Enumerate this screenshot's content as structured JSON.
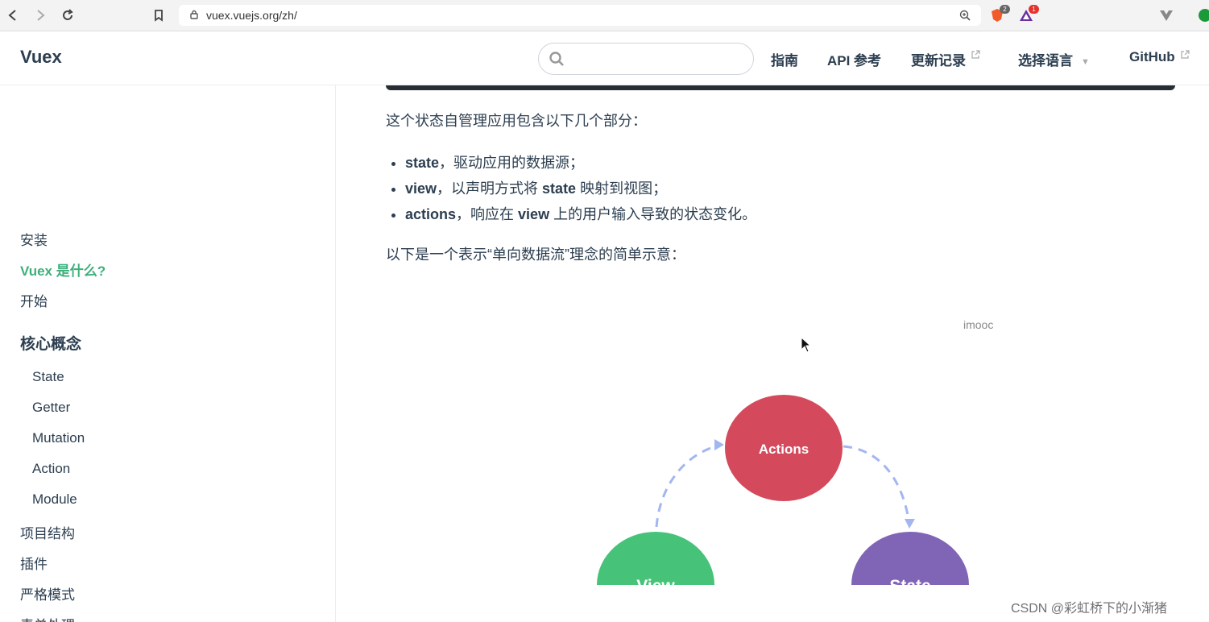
{
  "browser": {
    "url": "vuex.vuejs.org/zh/",
    "back_icon": "back-arrow-icon",
    "forward_icon": "forward-arrow-icon",
    "reload_icon": "reload-icon",
    "bookmark_icon": "bookmark-icon",
    "lock_icon": "lock-icon",
    "zoom_icon": "zoom-icon",
    "extensions": [
      {
        "name": "brave-shields-icon",
        "badge": "2"
      },
      {
        "name": "brave-rewards-icon",
        "badge": "1"
      }
    ]
  },
  "header": {
    "brand": "Vuex",
    "search_placeholder": "",
    "nav": [
      {
        "label": "指南"
      },
      {
        "label": "API 参考"
      },
      {
        "label": "更新记录",
        "external": true
      },
      {
        "label": "选择语言",
        "dropdown": true
      },
      {
        "label": "GitHub",
        "external": true
      }
    ]
  },
  "sidebar": {
    "items": [
      {
        "label": "安装"
      },
      {
        "label": "Vuex 是什么?",
        "active": true
      },
      {
        "label": "开始"
      }
    ],
    "heading": "核心概念",
    "sub_items": [
      "State",
      "Getter",
      "Mutation",
      "Action",
      "Module"
    ],
    "more_items": [
      "项目结构",
      "插件",
      "严格模式",
      "表单处理"
    ]
  },
  "content": {
    "intro": "这个状态自管理应用包含以下几个部分：",
    "list": [
      {
        "term": "state",
        "rest": "，驱动应用的数据源；"
      },
      {
        "term": "view",
        "rest_a": "，以声明方式将 ",
        "term2": "state",
        "rest_b": " 映射到视图；"
      },
      {
        "term": "actions",
        "rest_a": "，响应在 ",
        "term2": "view",
        "rest_b": " 上的用户输入导致的状态变化。"
      }
    ],
    "diagram_intro": "以下是一个表示“单向数据流”理念的简单示意：",
    "diagram": {
      "actions_label": "Actions",
      "state_label": "State",
      "view_label": "View",
      "actions_color": "#d44a5c",
      "state_color": "#8065b7",
      "view_color": "#46c378",
      "arrow_color": "#a3b6f0"
    },
    "imooc": "imooc"
  },
  "watermark": "CSDN @彩虹桥下的小渐猪"
}
